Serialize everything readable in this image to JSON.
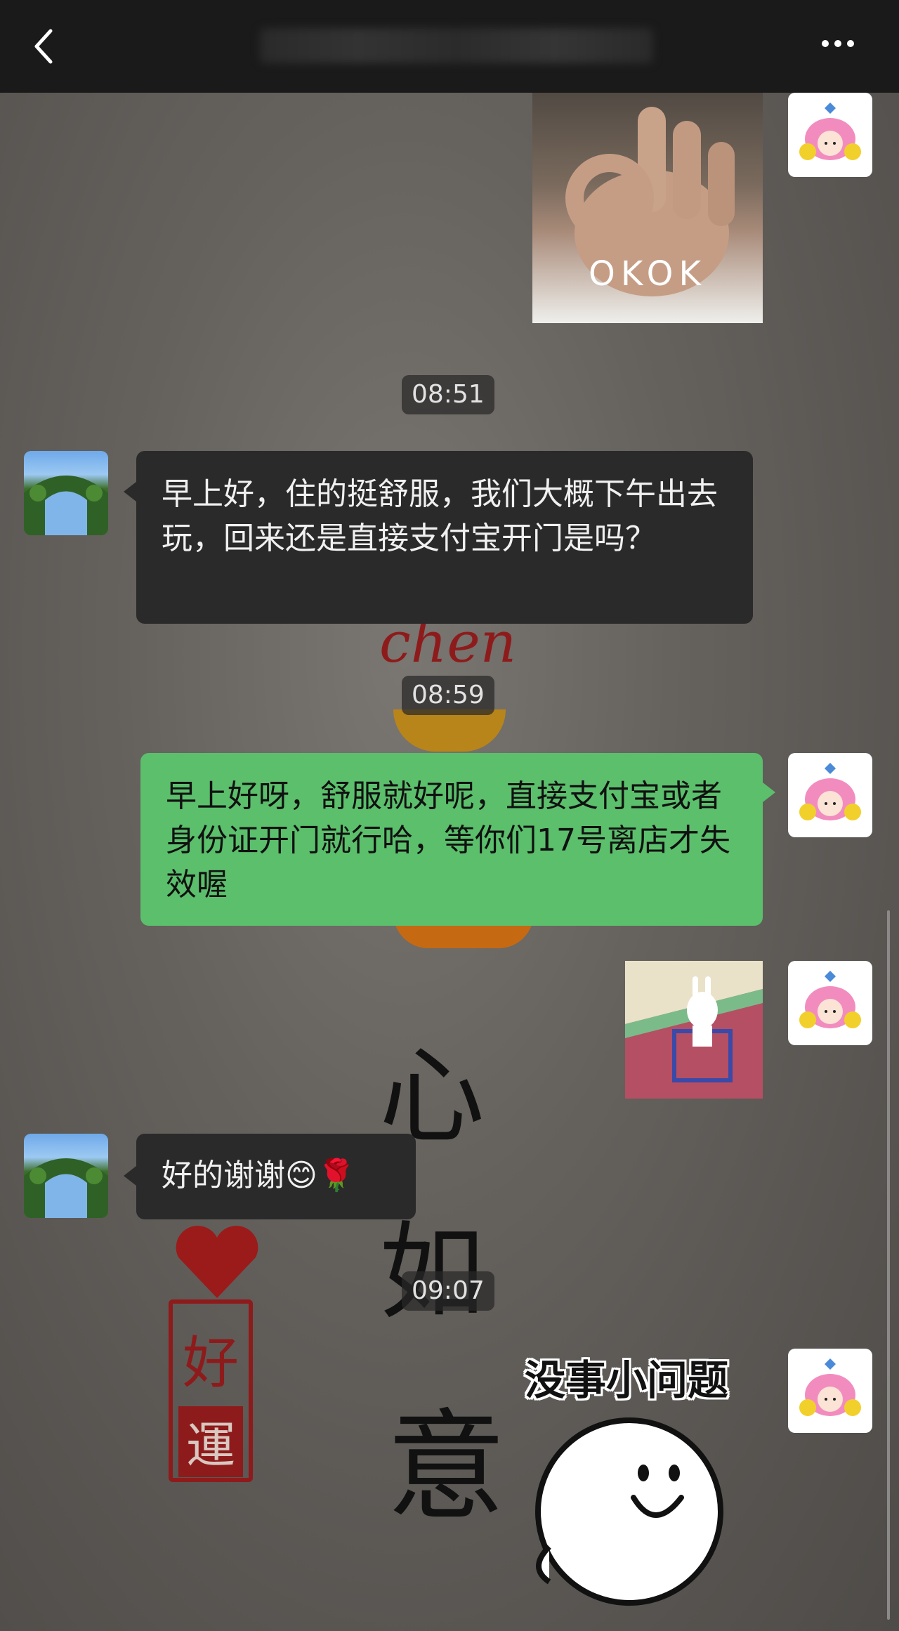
{
  "header": {
    "title": "",
    "back_icon": "chevron-left-icon",
    "more_icon": "more-dots-icon"
  },
  "messages": [
    {
      "type": "image",
      "side": "right",
      "sticker_text": "OKOK"
    },
    {
      "type": "timestamp",
      "text": "08:51"
    },
    {
      "type": "text",
      "side": "left",
      "text": "早上好，住的挺舒服，我们大概下午出去玩，回来还是直接支付宝开门是吗？"
    },
    {
      "type": "timestamp",
      "text": "08:59"
    },
    {
      "type": "text",
      "side": "right",
      "text": "早上好呀，舒服就好呢，直接支付宝或者身份证开门就行哈，等你们17号离店才失效喔"
    },
    {
      "type": "image",
      "side": "right",
      "sticker_text": ""
    },
    {
      "type": "text",
      "side": "left",
      "text": "好的谢谢😊🌹"
    },
    {
      "type": "timestamp",
      "text": "09:07"
    },
    {
      "type": "image",
      "side": "right",
      "sticker_text": "没事小问题"
    }
  ],
  "wallpaper": {
    "chen": "chen",
    "xin": "心",
    "ru": "如",
    "yi": "意",
    "seal_top": "好",
    "seal_bottom": "運"
  },
  "colors": {
    "topbar": "#1a1a1a",
    "bubble_dark": "#2a2a2a",
    "bubble_green": "#5bbf6c",
    "timestamp_bg": "#2d2d2d"
  }
}
